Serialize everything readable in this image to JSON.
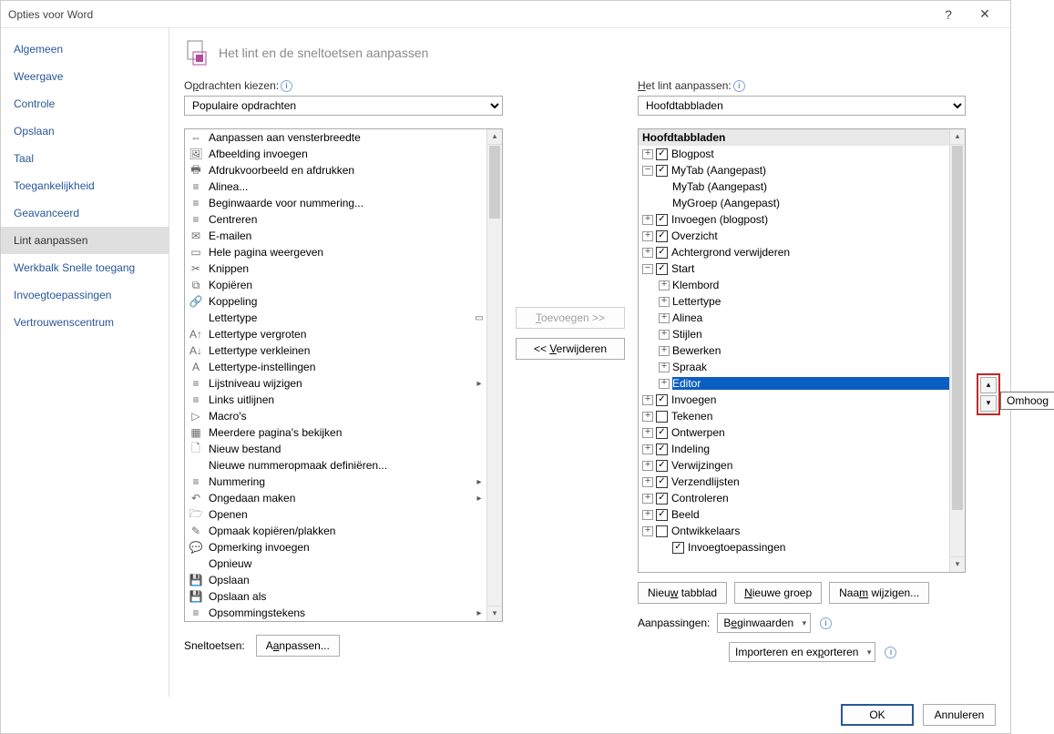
{
  "window": {
    "title": "Opties voor Word",
    "help": "?",
    "close": "✕"
  },
  "sidebar": {
    "items": [
      "Algemeen",
      "Weergave",
      "Controle",
      "Opslaan",
      "Taal",
      "Toegankelijkheid",
      "Geavanceerd",
      "Lint aanpassen",
      "Werkbalk Snelle toegang",
      "Invoegtoepassingen",
      "Vertrouwenscentrum"
    ],
    "selected": 7
  },
  "heading": "Het lint en de sneltoetsen aanpassen",
  "left": {
    "label_pre": "O",
    "label_und": "p",
    "label_post": "drachten kiezen:",
    "dropdown": "Populaire opdrachten",
    "commands": [
      {
        "icon": "⇔",
        "text": "Aanpassen aan vensterbreedte"
      },
      {
        "icon": "🖼",
        "text": "Afbeelding invoegen"
      },
      {
        "icon": "🖶",
        "text": "Afdrukvoorbeeld en afdrukken"
      },
      {
        "icon": "≡",
        "text": "Alinea..."
      },
      {
        "icon": "≡",
        "text": "Beginwaarde voor nummering..."
      },
      {
        "icon": "≡",
        "text": "Centreren"
      },
      {
        "icon": "✉",
        "text": "E-mailen"
      },
      {
        "icon": "▭",
        "text": "Hele pagina weergeven"
      },
      {
        "icon": "✂",
        "text": "Knippen"
      },
      {
        "icon": "⧉",
        "text": "Kopiëren"
      },
      {
        "icon": "🔗",
        "text": "Koppeling"
      },
      {
        "icon": "",
        "text": "Lettertype",
        "sub": "▭"
      },
      {
        "icon": "A↑",
        "text": "Lettertype vergroten"
      },
      {
        "icon": "A↓",
        "text": "Lettertype verkleinen"
      },
      {
        "icon": "A",
        "text": "Lettertype-instellingen"
      },
      {
        "icon": "≡",
        "text": "Lijstniveau wijzigen",
        "sub": "▸"
      },
      {
        "icon": "≡",
        "text": "Links uitlijnen"
      },
      {
        "icon": "▷",
        "text": "Macro's"
      },
      {
        "icon": "▦",
        "text": "Meerdere pagina's bekijken"
      },
      {
        "icon": "🗋",
        "text": "Nieuw bestand"
      },
      {
        "icon": "",
        "text": "Nieuwe nummeropmaak definiëren..."
      },
      {
        "icon": "≡",
        "text": "Nummering",
        "sub": "▸"
      },
      {
        "icon": "↶",
        "text": "Ongedaan maken",
        "sub": "▸"
      },
      {
        "icon": "🗁",
        "text": "Openen"
      },
      {
        "icon": "✎",
        "text": "Opmaak kopiëren/plakken"
      },
      {
        "icon": "💬",
        "text": "Opmerking invoegen"
      },
      {
        "icon": "",
        "text": "Opnieuw"
      },
      {
        "icon": "💾",
        "text": "Opslaan"
      },
      {
        "icon": "💾",
        "text": "Opslaan als"
      },
      {
        "icon": "≡",
        "text": "Opsommingstekens",
        "sub": "▸"
      }
    ],
    "shortcuts_label": "Sneltoetsen:",
    "customize_pre": "A",
    "customize_und": "a",
    "customize_post": "npassen..."
  },
  "mid": {
    "add_pre": "",
    "add_und": "T",
    "add_post": "oevoegen >>",
    "remove_pre": "<< ",
    "remove_und": "V",
    "remove_post": "erwijderen"
  },
  "right": {
    "label_pre": "",
    "label_und": "H",
    "label_post": "et lint aanpassen:",
    "dropdown": "Hoofdtabbladen",
    "tree_header": "Hoofdtabbladen",
    "tree": [
      {
        "d": 0,
        "exp": "+",
        "chk": true,
        "text": "Blogpost"
      },
      {
        "d": 0,
        "exp": "−",
        "chk": true,
        "text": "MyTab (Aangepast)"
      },
      {
        "d": 1,
        "text": "MyTab (Aangepast)"
      },
      {
        "d": 1,
        "text": "MyGroep (Aangepast)"
      },
      {
        "d": 0,
        "exp": "+",
        "chk": true,
        "text": "Invoegen (blogpost)"
      },
      {
        "d": 0,
        "exp": "+",
        "chk": true,
        "text": "Overzicht"
      },
      {
        "d": 0,
        "exp": "+",
        "chk": true,
        "text": "Achtergrond verwijderen"
      },
      {
        "d": 0,
        "exp": "−",
        "chk": true,
        "text": "Start"
      },
      {
        "d": 1,
        "exp": "+",
        "text": "Klembord"
      },
      {
        "d": 1,
        "exp": "+",
        "text": "Lettertype"
      },
      {
        "d": 1,
        "exp": "+",
        "text": "Alinea"
      },
      {
        "d": 1,
        "exp": "+",
        "text": "Stijlen"
      },
      {
        "d": 1,
        "exp": "+",
        "text": "Bewerken"
      },
      {
        "d": 1,
        "exp": "+",
        "text": "Spraak"
      },
      {
        "d": 1,
        "exp": "+",
        "text": "Editor",
        "sel": true
      },
      {
        "d": 0,
        "exp": "+",
        "chk": true,
        "text": "Invoegen"
      },
      {
        "d": 0,
        "exp": "+",
        "chk": false,
        "text": "Tekenen"
      },
      {
        "d": 0,
        "exp": "+",
        "chk": true,
        "text": "Ontwerpen"
      },
      {
        "d": 0,
        "exp": "+",
        "chk": true,
        "text": "Indeling"
      },
      {
        "d": 0,
        "exp": "+",
        "chk": true,
        "text": "Verwijzingen"
      },
      {
        "d": 0,
        "exp": "+",
        "chk": true,
        "text": "Verzendlijsten"
      },
      {
        "d": 0,
        "exp": "+",
        "chk": true,
        "text": "Controleren"
      },
      {
        "d": 0,
        "exp": "+",
        "chk": true,
        "text": "Beeld"
      },
      {
        "d": 0,
        "exp": "+",
        "chk": false,
        "text": "Ontwikkelaars"
      },
      {
        "d": 1,
        "chk": true,
        "text": "Invoegtoepassingen"
      }
    ],
    "btn_newtab_pre": "Nieu",
    "btn_newtab_und": "w",
    "btn_newtab_post": " tabblad",
    "btn_newgroup_pre": "",
    "btn_newgroup_und": "N",
    "btn_newgroup_post": "ieuwe groep",
    "btn_rename_pre": "Naa",
    "btn_rename_und": "m",
    "btn_rename_post": " wijzigen...",
    "customizations_label": "Aanpassingen:",
    "reset_pre": "B",
    "reset_und": "e",
    "reset_post": "ginwaarden",
    "importexport_pre": "Importeren en ex",
    "importexport_und": "p",
    "importexport_post": "orteren"
  },
  "footer": {
    "ok": "OK",
    "cancel": "Annuleren"
  },
  "float": {
    "up": "▴",
    "down": "▾",
    "tooltip": "Omhoog"
  }
}
